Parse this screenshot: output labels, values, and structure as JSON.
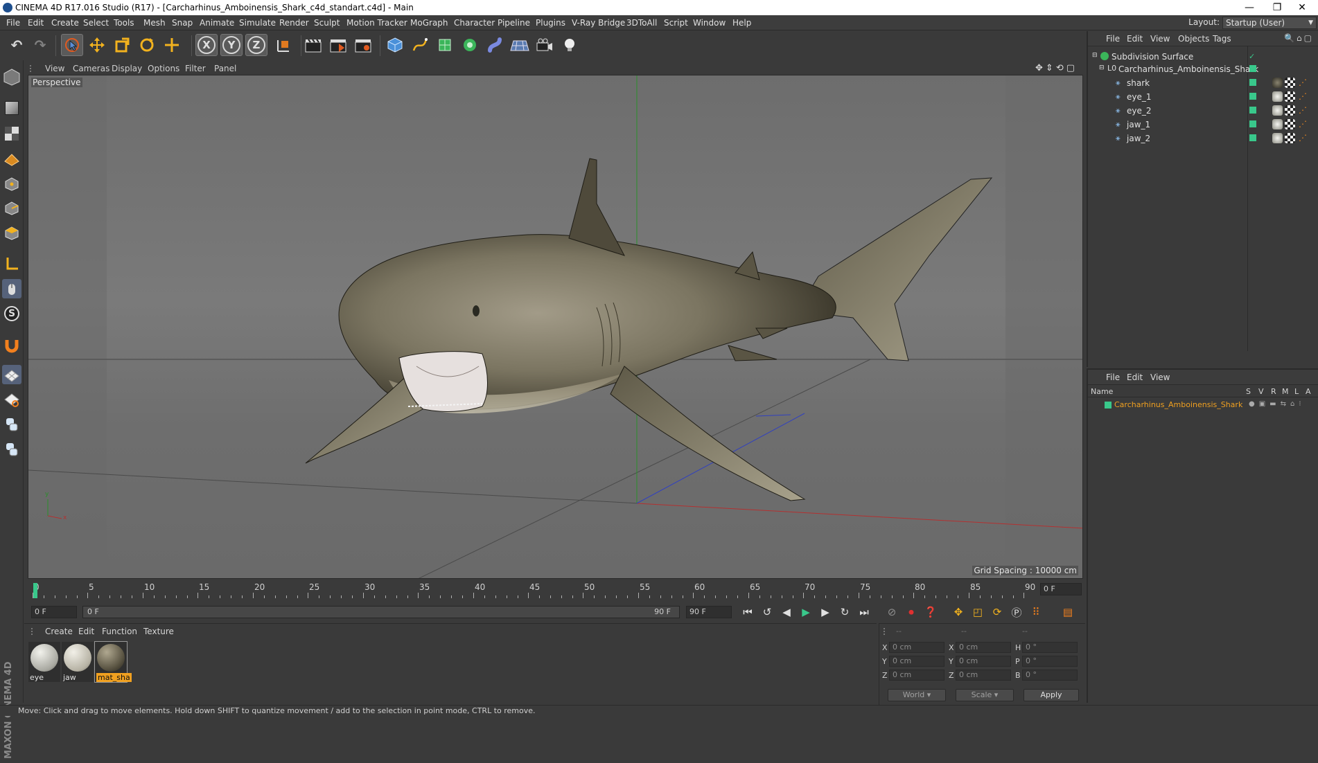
{
  "window": {
    "title": "CINEMA 4D R17.016 Studio (R17) - [Carcharhinus_Amboinensis_Shark_c4d_standart.c4d] - Main",
    "controls": [
      "—",
      "❐",
      "✕"
    ]
  },
  "menubar": {
    "items": [
      "File",
      "Edit",
      "Create",
      "Select",
      "Tools",
      "Mesh",
      "Snap",
      "Animate",
      "Simulate",
      "Render",
      "Sculpt",
      "Motion Tracker",
      "MoGraph",
      "Character",
      "Pipeline",
      "Plugins",
      "V-Ray Bridge",
      "3DToAll",
      "Script",
      "Window",
      "Help"
    ],
    "layout_label": "Layout:",
    "layout_value": "Startup (User)"
  },
  "toolbar": {
    "axis_x": "X",
    "axis_y": "Y",
    "axis_z": "Z"
  },
  "viewport": {
    "menu": [
      "View",
      "Cameras",
      "Display",
      "Options",
      "Filter",
      "Panel"
    ],
    "label": "Perspective",
    "grid_spacing": "Grid Spacing : 10000 cm",
    "axis_y": "y",
    "axis_x": "x"
  },
  "object_manager": {
    "menu": [
      "File",
      "Edit",
      "View",
      "Objects",
      "Tags"
    ],
    "objects": [
      {
        "name": "Subdivision Surface",
        "indent": 0
      },
      {
        "name": "Carcharhinus_Amboinensis_Shark",
        "indent": 1
      },
      {
        "name": "shark",
        "indent": 2
      },
      {
        "name": "eye_1",
        "indent": 2
      },
      {
        "name": "eye_2",
        "indent": 2
      },
      {
        "name": "jaw_1",
        "indent": 2
      },
      {
        "name": "jaw_2",
        "indent": 2
      }
    ]
  },
  "attribute_manager": {
    "menu": [
      "File",
      "Edit",
      "View"
    ],
    "header_name": "Name",
    "header_cols": [
      "S",
      "V",
      "R",
      "M",
      "L",
      "A"
    ],
    "layer_name": "Carcharhinus_Amboinensis_Shark"
  },
  "timeline": {
    "ticks": [
      "0",
      "5",
      "10",
      "15",
      "20",
      "25",
      "30",
      "35",
      "40",
      "45",
      "50",
      "55",
      "60",
      "65",
      "70",
      "75",
      "80",
      "85",
      "90"
    ],
    "current_frame": "0 F",
    "start_frame": "0 F",
    "range_start": "0 F",
    "range_end": "90 F",
    "end_frame": "90 F"
  },
  "material_manager": {
    "menu": [
      "Create",
      "Edit",
      "Function",
      "Texture"
    ],
    "materials": [
      "eye",
      "jaw",
      "mat_sha"
    ]
  },
  "coordinates": {
    "header": [
      "--",
      "--",
      "--"
    ],
    "rows": [
      {
        "a": "X",
        "av": "0 cm",
        "b": "X",
        "bv": "0 cm",
        "c": "H",
        "cv": "0 °"
      },
      {
        "a": "Y",
        "av": "0 cm",
        "b": "Y",
        "bv": "0 cm",
        "c": "P",
        "cv": "0 °"
      },
      {
        "a": "Z",
        "av": "0 cm",
        "b": "Z",
        "bv": "0 cm",
        "c": "B",
        "cv": "0 °"
      }
    ],
    "space": "World",
    "mode": "Scale",
    "apply": "Apply"
  },
  "branding": "MAXON CINEMA 4D",
  "status": "Move: Click and drag to move elements. Hold down SHIFT to quantize movement / add to the selection in point mode, CTRL to remove.",
  "colors": {
    "accent_green": "#39c88b",
    "selected_orange": "#f0a020",
    "axis_red": "#c03030",
    "axis_green": "#30a030",
    "axis_blue": "#3040c0"
  }
}
